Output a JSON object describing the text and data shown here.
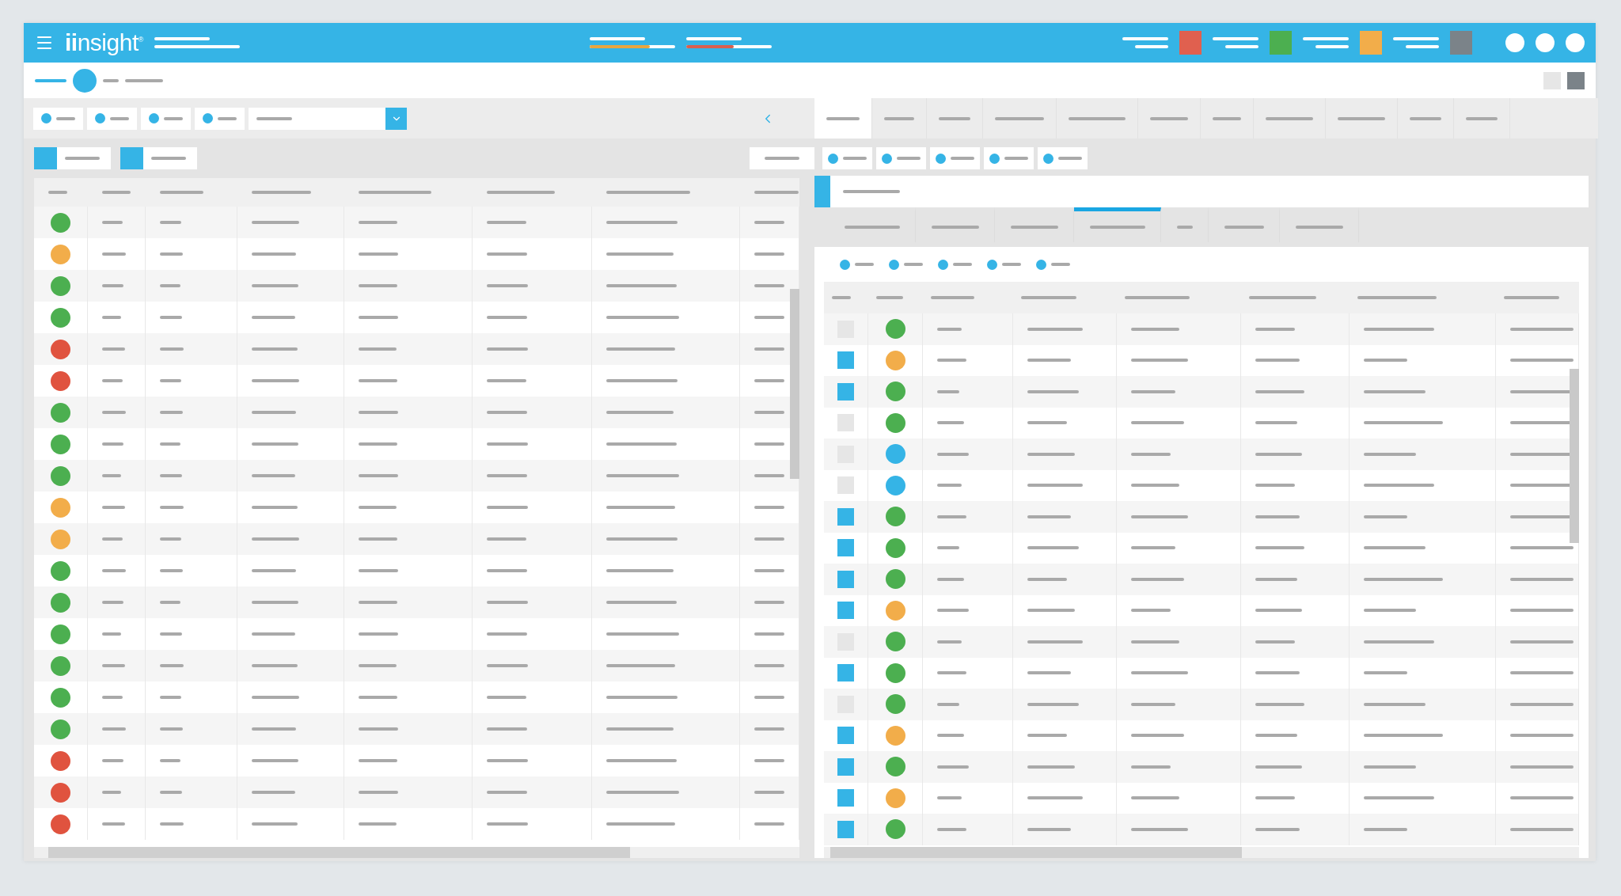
{
  "topbar": {
    "logo": "**ii**nsight$^{®}$",
    "meters": [
      {
        "level": 0.7,
        "color": "#e8a640"
      },
      {
        "level": 0.55,
        "color": "#d9604f"
      }
    ],
    "status_tiles": [
      {
        "color": "#e0604f"
      },
      {
        "color": "#4caf50"
      },
      {
        "color": "#f2ad4a"
      },
      {
        "color": "#7b8389"
      }
    ]
  },
  "right_panel": {
    "tabs": [
      {
        "selected": true
      },
      {
        "selected": false
      },
      {
        "selected": false
      },
      {
        "selected": false
      },
      {
        "selected": false
      },
      {
        "selected": false
      },
      {
        "selected": false
      },
      {
        "selected": false
      },
      {
        "selected": false
      },
      {
        "selected": false
      },
      {
        "selected": false
      }
    ],
    "subtabs": [
      {
        "selected": false
      },
      {
        "selected": false
      },
      {
        "selected": false
      },
      {
        "selected": true
      },
      {
        "selected": false
      },
      {
        "selected": false
      },
      {
        "selected": false
      }
    ],
    "rows": [
      {
        "checked": false,
        "color": "#4caf50"
      },
      {
        "checked": true,
        "color": "#f2ad4a"
      },
      {
        "checked": true,
        "color": "#4caf50"
      },
      {
        "checked": false,
        "color": "#4caf50"
      },
      {
        "checked": false,
        "color": "#35b4e6"
      },
      {
        "checked": false,
        "color": "#35b4e6"
      },
      {
        "checked": true,
        "color": "#4caf50"
      },
      {
        "checked": true,
        "color": "#4caf50"
      },
      {
        "checked": true,
        "color": "#4caf50"
      },
      {
        "checked": true,
        "color": "#f2ad4a"
      },
      {
        "checked": false,
        "color": "#4caf50"
      },
      {
        "checked": true,
        "color": "#4caf50"
      },
      {
        "checked": false,
        "color": "#4caf50"
      },
      {
        "checked": true,
        "color": "#f2ad4a"
      },
      {
        "checked": true,
        "color": "#4caf50"
      },
      {
        "checked": true,
        "color": "#f2ad4a"
      },
      {
        "checked": true,
        "color": "#4caf50"
      }
    ]
  },
  "left_panel": {
    "rows": [
      {
        "color": "#4caf50"
      },
      {
        "color": "#f2ad4a"
      },
      {
        "color": "#4caf50"
      },
      {
        "color": "#4caf50"
      },
      {
        "color": "#e0533f"
      },
      {
        "color": "#e0533f"
      },
      {
        "color": "#4caf50"
      },
      {
        "color": "#4caf50"
      },
      {
        "color": "#4caf50"
      },
      {
        "color": "#f2ad4a"
      },
      {
        "color": "#f2ad4a"
      },
      {
        "color": "#4caf50"
      },
      {
        "color": "#4caf50"
      },
      {
        "color": "#4caf50"
      },
      {
        "color": "#4caf50"
      },
      {
        "color": "#4caf50"
      },
      {
        "color": "#4caf50"
      },
      {
        "color": "#e0533f"
      },
      {
        "color": "#e0533f"
      },
      {
        "color": "#e0533f"
      }
    ]
  }
}
